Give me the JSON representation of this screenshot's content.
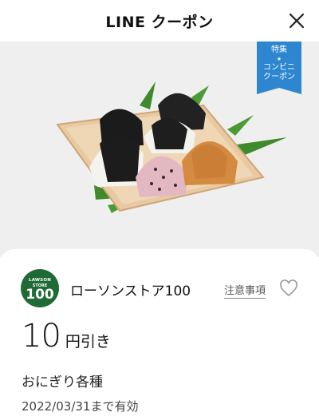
{
  "header": {
    "title": "LINE クーポン",
    "close_icon": "close-icon"
  },
  "hero": {
    "badge": {
      "line1": "特集",
      "line2": "コンビニ",
      "line3": "クーポン"
    },
    "colors": {
      "background": "#efefef",
      "badge": "#2d86cf"
    }
  },
  "coupon": {
    "store_logo": {
      "line1": "LAWSON",
      "line2": "STORE",
      "line3": "100",
      "color": "#1f6a35"
    },
    "store_name": "ローソンストア100",
    "notice_label": "注意事項",
    "discount_value": "10",
    "discount_unit": "円引き",
    "item_name": "おにぎり各種",
    "validity": "2022/03/31まで有効"
  }
}
